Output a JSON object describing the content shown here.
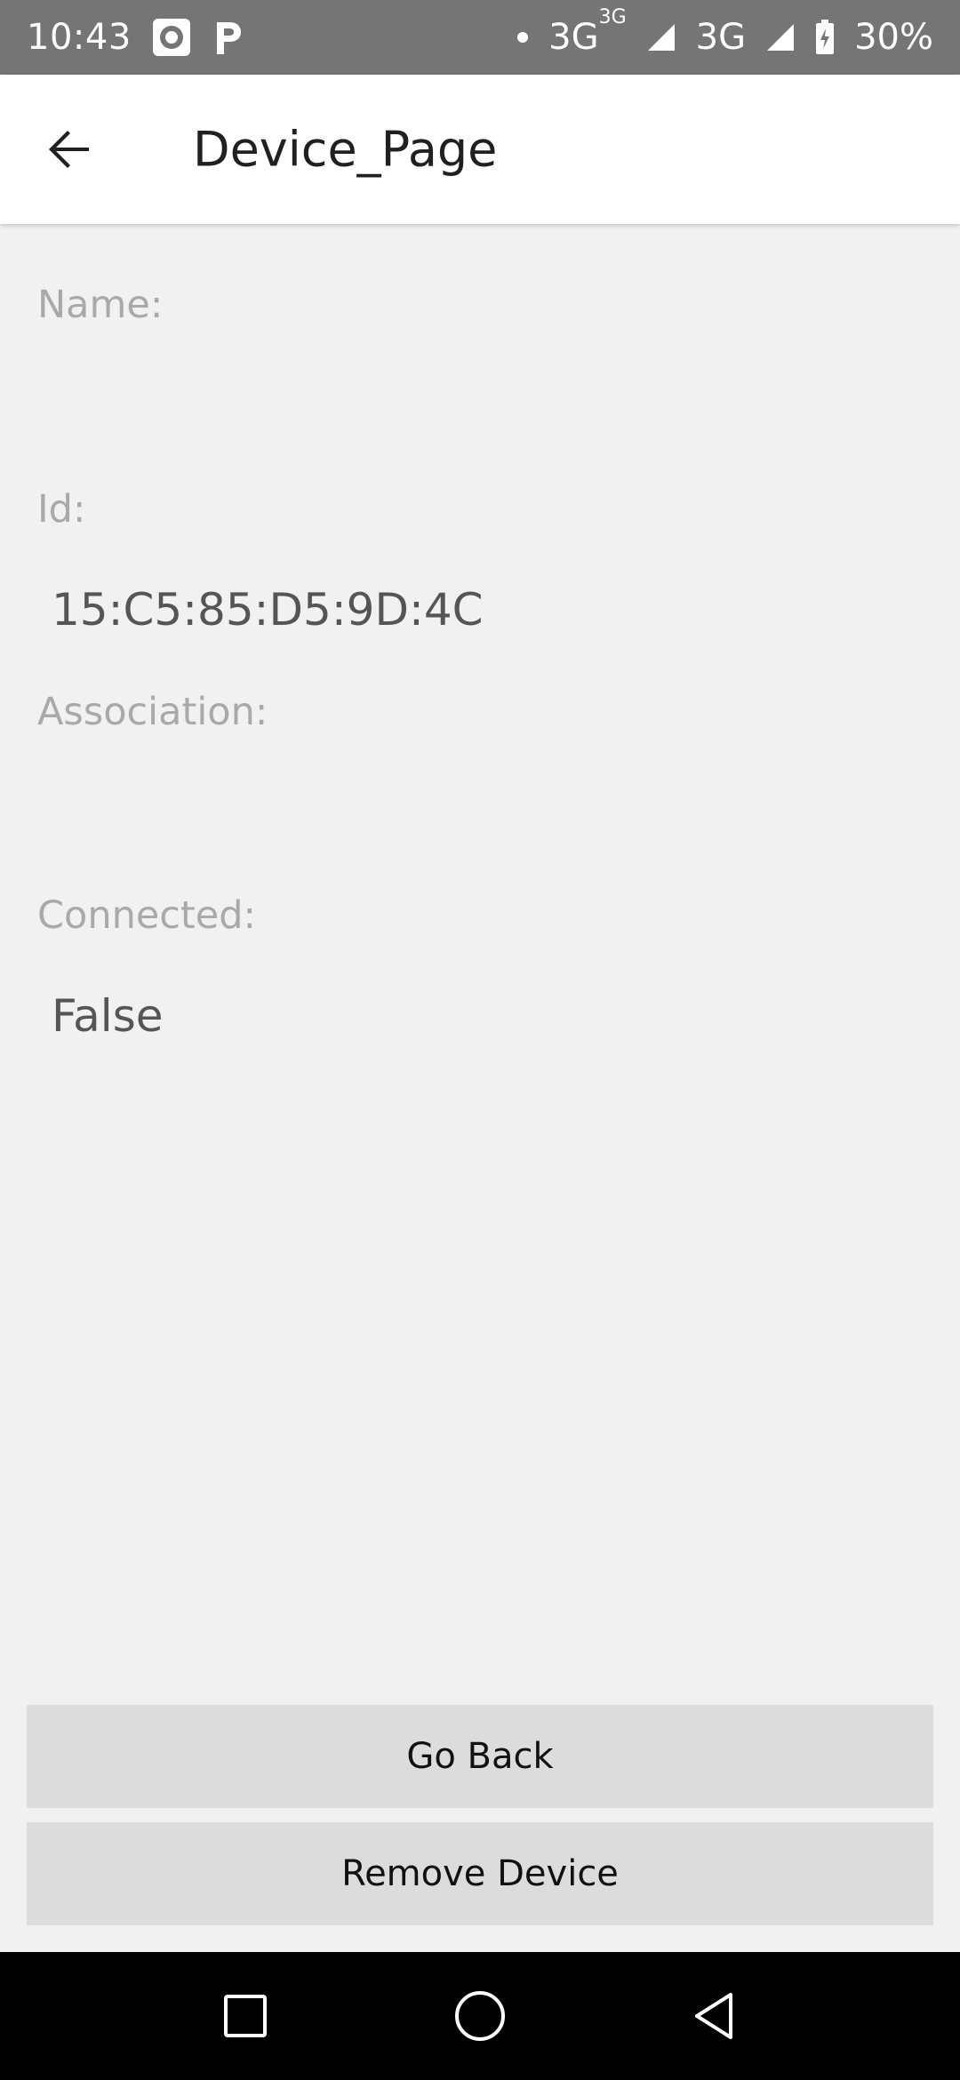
{
  "status_bar": {
    "time": "10:43",
    "network_1": "3G",
    "network_1_superscript": "3G",
    "network_2": "3G",
    "battery": "30%",
    "icons": [
      "target-icon",
      "p-icon",
      "dot-icon",
      "signal-icon",
      "battery-icon"
    ]
  },
  "app_bar": {
    "title": "Device_Page",
    "back_icon": "arrow-back-icon"
  },
  "device": {
    "name_label": "Name:",
    "name_value": "",
    "id_label": "Id:",
    "id_value": "15:C5:85:D5:9D:4C",
    "association_label": "Association:",
    "association_value": "",
    "connected_label": "Connected:",
    "connected_value": "False"
  },
  "buttons": {
    "go_back": "Go Back",
    "remove_device": "Remove Device"
  },
  "nav_bar": {
    "icons": [
      "square-icon",
      "circle-icon",
      "triangle-back-icon"
    ]
  },
  "colors": {
    "status_bar": "#757575",
    "background": "#f1f1f1",
    "app_bar": "#ffffff",
    "button": "#dcdcdc",
    "label": "#a9a9a9",
    "value": "#555555",
    "nav_bar": "#000000"
  }
}
